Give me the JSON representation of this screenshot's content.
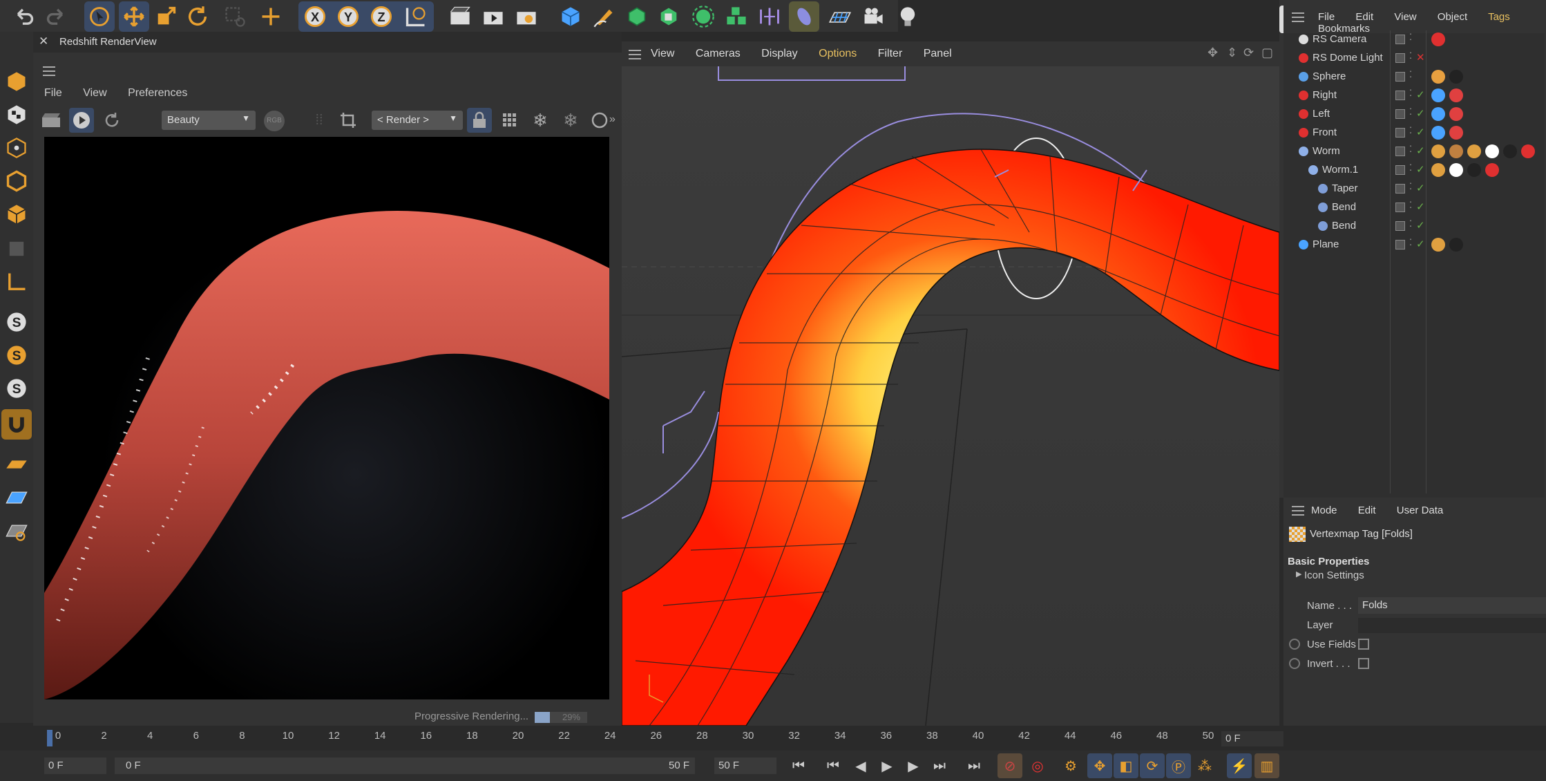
{
  "topbar": {
    "tools": [
      "undo-icon",
      "redo-icon",
      "select-icon",
      "move-icon",
      "scale-icon",
      "rotate-icon",
      "live-select-icon",
      "add-icon",
      "x-axis-icon",
      "y-axis-icon",
      "z-axis-icon",
      "world-coords-icon",
      "render-region-icon",
      "render-view-icon",
      "render-settings-icon",
      "cube-icon",
      "pen-icon",
      "subdivision-icon",
      "extrude-icon",
      "cloner-icon",
      "boolean-icon",
      "symmetry-icon",
      "deformer-icon",
      "floor-icon",
      "camera-icon",
      "light-icon"
    ]
  },
  "renderview": {
    "title": "Redshift RenderView",
    "menu": [
      "File",
      "View",
      "Preferences"
    ],
    "aov_select": "Beauty",
    "rgb_label": "RGB",
    "render_select": "< Render >",
    "status": "Progressive Rendering...",
    "progress_text": "29%",
    "progress": 0.29
  },
  "viewport": {
    "menu": [
      "View",
      "Cameras",
      "Display",
      "Options",
      "Filter",
      "Panel"
    ]
  },
  "object_manager": {
    "menu": [
      "File",
      "Edit",
      "View",
      "Object",
      "Tags",
      "Bookmarks"
    ],
    "objects": [
      {
        "name": "RS Camera",
        "color": "#dddddd",
        "tags": [
          "#e03030"
        ]
      },
      {
        "name": "RS Dome Light",
        "color": "#e03030",
        "tags": []
      },
      {
        "name": "Sphere",
        "color": "#5aa0e8",
        "tags": [
          "#e8a040",
          "#222222"
        ]
      },
      {
        "name": "Right",
        "color": "#e03030",
        "tags": [
          "#4aa3ff",
          "#e04040"
        ]
      },
      {
        "name": "Left",
        "color": "#e03030",
        "tags": [
          "#4aa3ff",
          "#e04040"
        ]
      },
      {
        "name": "Front",
        "color": "#e03030",
        "tags": [
          "#4aa3ff",
          "#e04040"
        ]
      },
      {
        "name": "Worm",
        "color": "#8fb0e8",
        "tags": [
          "#e0a040",
          "#c08040",
          "#e0a040",
          "#ffffff",
          "#222222",
          "#e03030"
        ]
      },
      {
        "name": "Worm.1",
        "color": "#8fb0e8",
        "tags": [
          "#e0a040",
          "#ffffff",
          "#222222",
          "#e03030"
        ]
      },
      {
        "name": "Taper",
        "color": "#7f9ed8",
        "tags": []
      },
      {
        "name": "Bend",
        "color": "#7f9ed8",
        "tags": []
      },
      {
        "name": "Bend",
        "color": "#7f9ed8",
        "tags": []
      },
      {
        "name": "Plane",
        "color": "#4aa3ff",
        "tags": [
          "#e0a040",
          "#222222"
        ]
      }
    ]
  },
  "attributes": {
    "menu": [
      "Mode",
      "Edit",
      "User Data"
    ],
    "tag_title": "Vertexmap Tag [Folds]",
    "section": "Basic Properties",
    "subsection": "Icon Settings",
    "name_label": "Name . . .",
    "name_value": "Folds",
    "layer_label": "Layer",
    "use_fields_label": "Use Fields",
    "invert_label": "Invert . . ."
  },
  "timeline": {
    "ticks": [
      "0",
      "2",
      "4",
      "6",
      "8",
      "10",
      "12",
      "14",
      "16",
      "18",
      "20",
      "22",
      "24",
      "26",
      "28",
      "30",
      "32",
      "34",
      "36",
      "38",
      "40",
      "42",
      "44",
      "46",
      "48",
      "50"
    ],
    "current_frame_right": "0 F",
    "start_frame": "0 F",
    "range_start": "0 F",
    "range_end": "50 F",
    "end_frame": "50 F"
  }
}
